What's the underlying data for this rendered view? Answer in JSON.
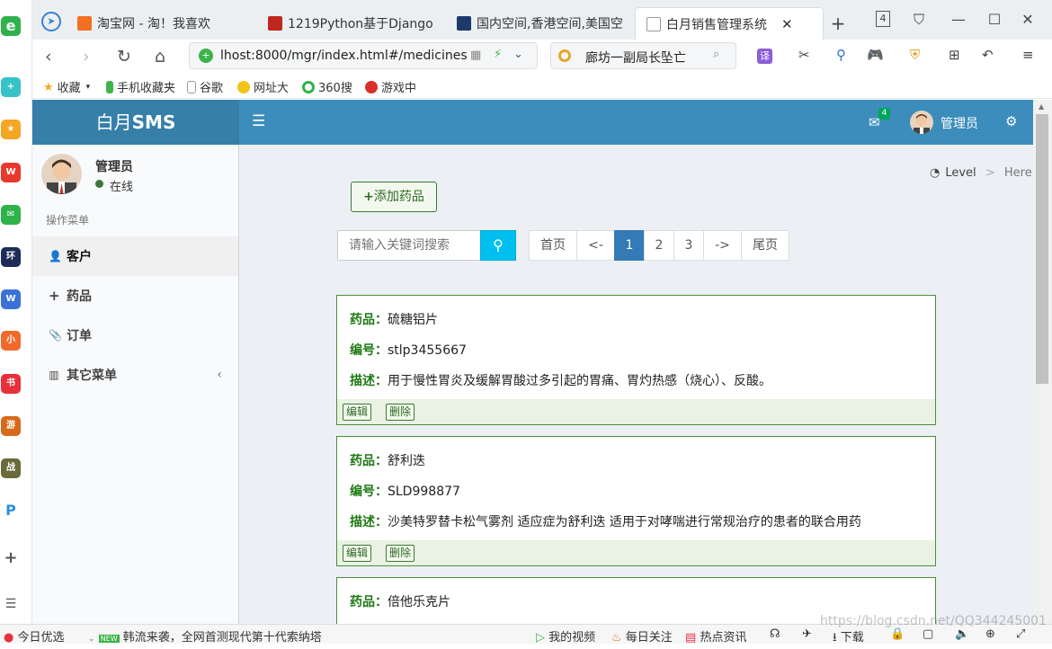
{
  "browser": {
    "tabs": [
      {
        "title": "淘宝网 - 淘！我喜欢",
        "icon": "taobao-icon"
      },
      {
        "title": "1219Python基于Django",
        "icon": "book-icon"
      },
      {
        "title": "国内空间,香港空间,美国空",
        "icon": "idc-icon"
      },
      {
        "title": "白月销售管理系统",
        "icon": "page-icon"
      }
    ],
    "tab_count": "4",
    "url": "lhost:8000/mgr/index.html#/medicines",
    "search_text": "廊坊一副局长坠亡",
    "bookmarks": [
      "收藏",
      "手机收藏夹",
      "谷歌",
      "网址大",
      "360搜",
      "游戏中"
    ],
    "translate": "译"
  },
  "app": {
    "logo_light": "白月",
    "logo_bold": "SMS",
    "mail_badge": "4",
    "user_name": "管理员"
  },
  "sidebar": {
    "user_name": "管理员",
    "status": "在线",
    "section_title": "操作菜单",
    "items": [
      {
        "label": "客户",
        "icon": "user-icon"
      },
      {
        "label": "药品",
        "icon": "plus-icon"
      },
      {
        "label": "订单",
        "icon": "paperclip-icon"
      },
      {
        "label": "其它菜单",
        "icon": "bar-chart-icon"
      }
    ]
  },
  "breadcrumb": {
    "level": "Level",
    "sep": ">",
    "here": "Here"
  },
  "main": {
    "add_button": "添加药品",
    "search_placeholder": "请输入关键词搜索",
    "pagination": [
      "首页",
      "<-",
      "1",
      "2",
      "3",
      "->",
      "尾页"
    ],
    "active_page": "1",
    "field_labels": {
      "name": "药品：",
      "code": "编号：",
      "desc": "描述："
    },
    "edit_label": "编辑",
    "delete_label": "删除",
    "medicines": [
      {
        "name": "硫糖铝片",
        "code": "stlp3455667",
        "desc": "用于慢性胃炎及缓解胃酸过多引起的胃痛、胃灼热感（烧心）、反酸。"
      },
      {
        "name": "舒利迭",
        "code": "SLD998877",
        "desc": "沙美特罗替卡松气雾剂 适应症为舒利迭 适用于对哮喘进行常规治疗的患者的联合用药"
      },
      {
        "name": "倍他乐克片",
        "code": "",
        "desc": ""
      }
    ]
  },
  "statusbar": {
    "left": "今日优选",
    "news_badge": "NEW",
    "news": "韩流来袭，全网首测现代第十代索纳塔",
    "video": "我的视频",
    "follow": "每日关注",
    "hot": "热点资讯",
    "download": "下载",
    "watermark": "https://blog.csdn.net/QQ344245001"
  }
}
